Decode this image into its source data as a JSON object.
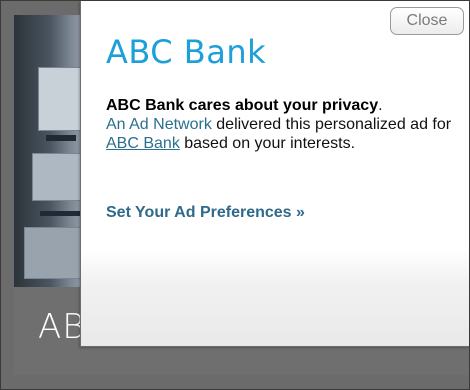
{
  "ad": {
    "banner_text": "AB"
  },
  "panel": {
    "close_label": "Close",
    "brand_title": "ABC Bank",
    "lead_text": "ABC Bank cares about your privacy",
    "lead_punct": ".",
    "network_text": "An Ad Network",
    "delivered_text": " delivered this personalized ad for ",
    "advertiser_link": "ABC Bank",
    "interest_text": " based on your interests.",
    "preferences_link": "Set Your Ad Preferences »"
  },
  "colors": {
    "brand": "#1d9fd9",
    "link": "#2b6f8f",
    "frame": "#6b6b6b"
  }
}
